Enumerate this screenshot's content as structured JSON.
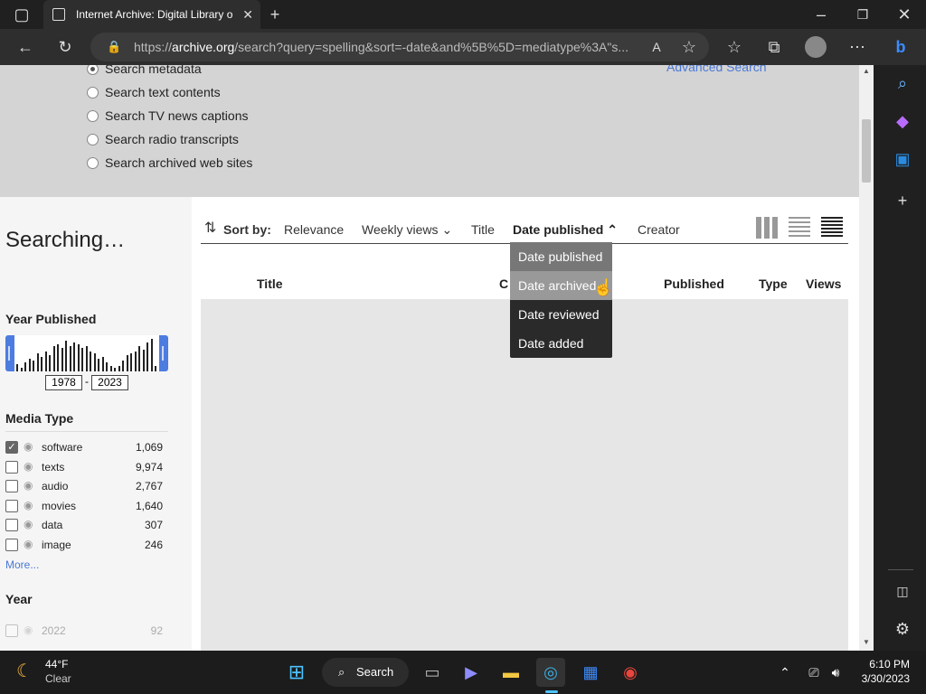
{
  "browser": {
    "tab_title": "Internet Archive: Digital Library o",
    "url_prefix": "https://",
    "url_domain": "archive.org",
    "url_rest": "/search?query=spelling&sort=-date&and%5B%5D=mediatype%3A\"s...",
    "icons": [
      "tab-list-icon",
      "back-icon",
      "refresh-icon",
      "lock-icon",
      "read-aloud-icon",
      "favorite-icon",
      "favorites-icon",
      "collections-icon",
      "profile-icon",
      "more-icon",
      "bing-icon"
    ]
  },
  "search_options": {
    "items": [
      "Search metadata",
      "Search text contents",
      "Search TV news captions",
      "Search radio transcripts",
      "Search archived web sites"
    ],
    "advanced": "Advanced Search"
  },
  "left": {
    "searching": "Searching…",
    "year_published": "Year Published",
    "year_from": "1978",
    "year_sep": "-",
    "year_to": "2023",
    "media_type": "Media Type",
    "media": [
      {
        "label": "software",
        "count": "1,069",
        "checked": true
      },
      {
        "label": "texts",
        "count": "9,974",
        "checked": false
      },
      {
        "label": "audio",
        "count": "2,767",
        "checked": false
      },
      {
        "label": "movies",
        "count": "1,640",
        "checked": false
      },
      {
        "label": "data",
        "count": "307",
        "checked": false
      },
      {
        "label": "image",
        "count": "246",
        "checked": false
      }
    ],
    "more": "More...",
    "year": "Year",
    "year_row": {
      "label": "2022",
      "count": "92"
    }
  },
  "sort": {
    "label": "Sort by:",
    "options": [
      "Relevance",
      "Weekly views",
      "Title",
      "Date published",
      "Creator"
    ],
    "active": "Date published"
  },
  "columns": [
    "Title",
    "C",
    "Published",
    "Type",
    "Views"
  ],
  "dropdown": [
    "Date published",
    "Date archived",
    "Date reviewed",
    "Date added"
  ],
  "taskbar": {
    "temp": "44°F",
    "weather": "Clear",
    "search": "Search",
    "time": "6:10 PM",
    "date": "3/30/2023"
  }
}
